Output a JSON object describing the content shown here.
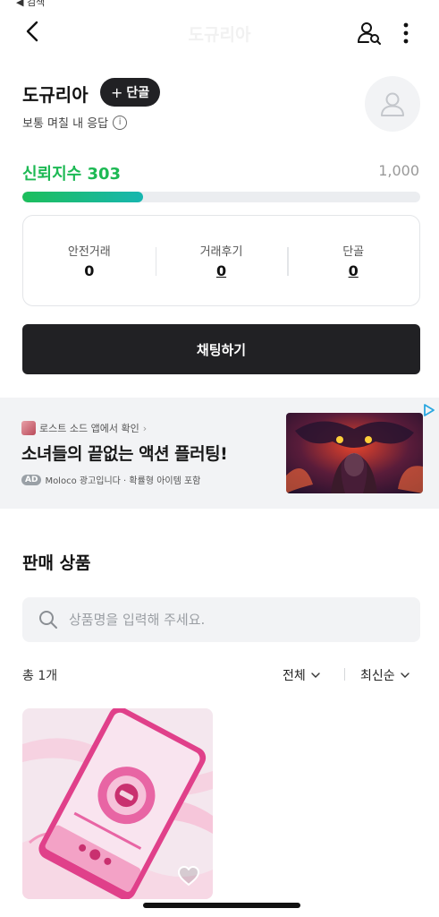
{
  "status": {
    "back_label": "◀ 검색"
  },
  "header": {
    "title": "도규리아"
  },
  "profile": {
    "name": "도규리아",
    "follow_label": "단골",
    "response_text": "보통 며칠 내 응답"
  },
  "trust": {
    "label": "신뢰지수 303",
    "max_label": "1,000",
    "score": 303,
    "max": 1000
  },
  "stats": [
    {
      "label": "안전거래",
      "value": "0"
    },
    {
      "label": "거래후기",
      "value": "0"
    },
    {
      "label": "단골",
      "value": "0"
    }
  ],
  "chat": {
    "label": "채팅하기"
  },
  "ad": {
    "source": "로스트 소드 앱에서 확인",
    "headline": "소녀들의 끝없는 액션 플러팅!",
    "badge": "AD",
    "disclaimer": "Moloco 광고입니다 · 확률형 아이템 포함"
  },
  "products_section": {
    "title": "판매 상품",
    "search_placeholder": "상품명을 입력해 주세요.",
    "count": "총 1개",
    "filter_label": "전체",
    "sort_label": "최신순"
  },
  "colors": {
    "accent_green": "#1db954",
    "dark_button": "#212124",
    "muted_bg": "#f2f3f5"
  },
  "icons": [
    "back-icon",
    "user-search-icon",
    "more-icon",
    "info-icon",
    "avatar-placeholder-icon",
    "search-icon",
    "chevron-down-icon",
    "heart-icon",
    "adchoices-icon"
  ]
}
